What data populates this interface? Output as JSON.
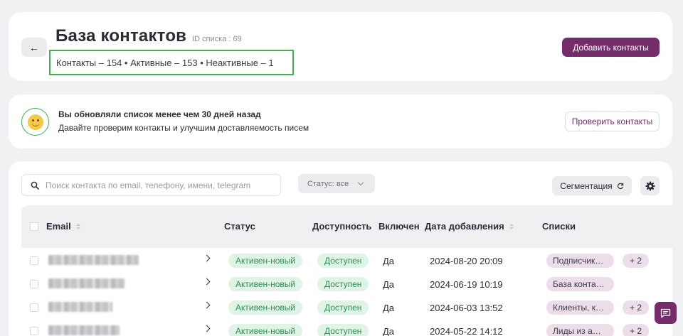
{
  "header": {
    "back_icon": "arrow-left-icon",
    "title": "База контактов",
    "list_id": "ID списка : 69",
    "counts": "Контакты – 154 • Активные – 153 • Неактивные – 1",
    "add_button": "Добавить контакты"
  },
  "info": {
    "icon": "smiley-icon",
    "title": "Вы обновляли список менее чем 30 дней назад",
    "subtitle": "Давайте проверим контакты и улучшим доставляемость писем",
    "check_button": "Проверить контакты"
  },
  "toolbar": {
    "search_placeholder": "Поиск контакта по email, телефону, имени, telegram",
    "status_filter": "Статус: все",
    "segmentation_button": "Сегментация",
    "settings_icon": "gear-icon"
  },
  "table": {
    "columns": [
      "Email",
      "Статус",
      "Доступность",
      "Включен",
      "Дата добавления",
      "Списки"
    ],
    "rows": [
      {
        "status": "Активен-новый",
        "availability": "Доступен",
        "enabled": "Да",
        "date": "2024-08-20 20:09",
        "list": "Подписчики …",
        "more": "+ 2"
      },
      {
        "status": "Активен-новый",
        "availability": "Доступен",
        "enabled": "Да",
        "date": "2024-06-19 10:19",
        "list": "База контак…",
        "more": ""
      },
      {
        "status": "Активен-новый",
        "availability": "Доступен",
        "enabled": "Да",
        "date": "2024-06-03 13:52",
        "list": "Клиенты, ко…",
        "more": "+ 2"
      },
      {
        "status": "Активен-новый",
        "availability": "Доступен",
        "enabled": "Да",
        "date": "2024-05-22 14:12",
        "list": "Лиды из am…",
        "more": "+ 2"
      }
    ]
  },
  "colors": {
    "brand": "#742c6a",
    "success_bg": "#dff3e6",
    "success_text": "#2e8f57",
    "highlight": "#3fb24a"
  }
}
